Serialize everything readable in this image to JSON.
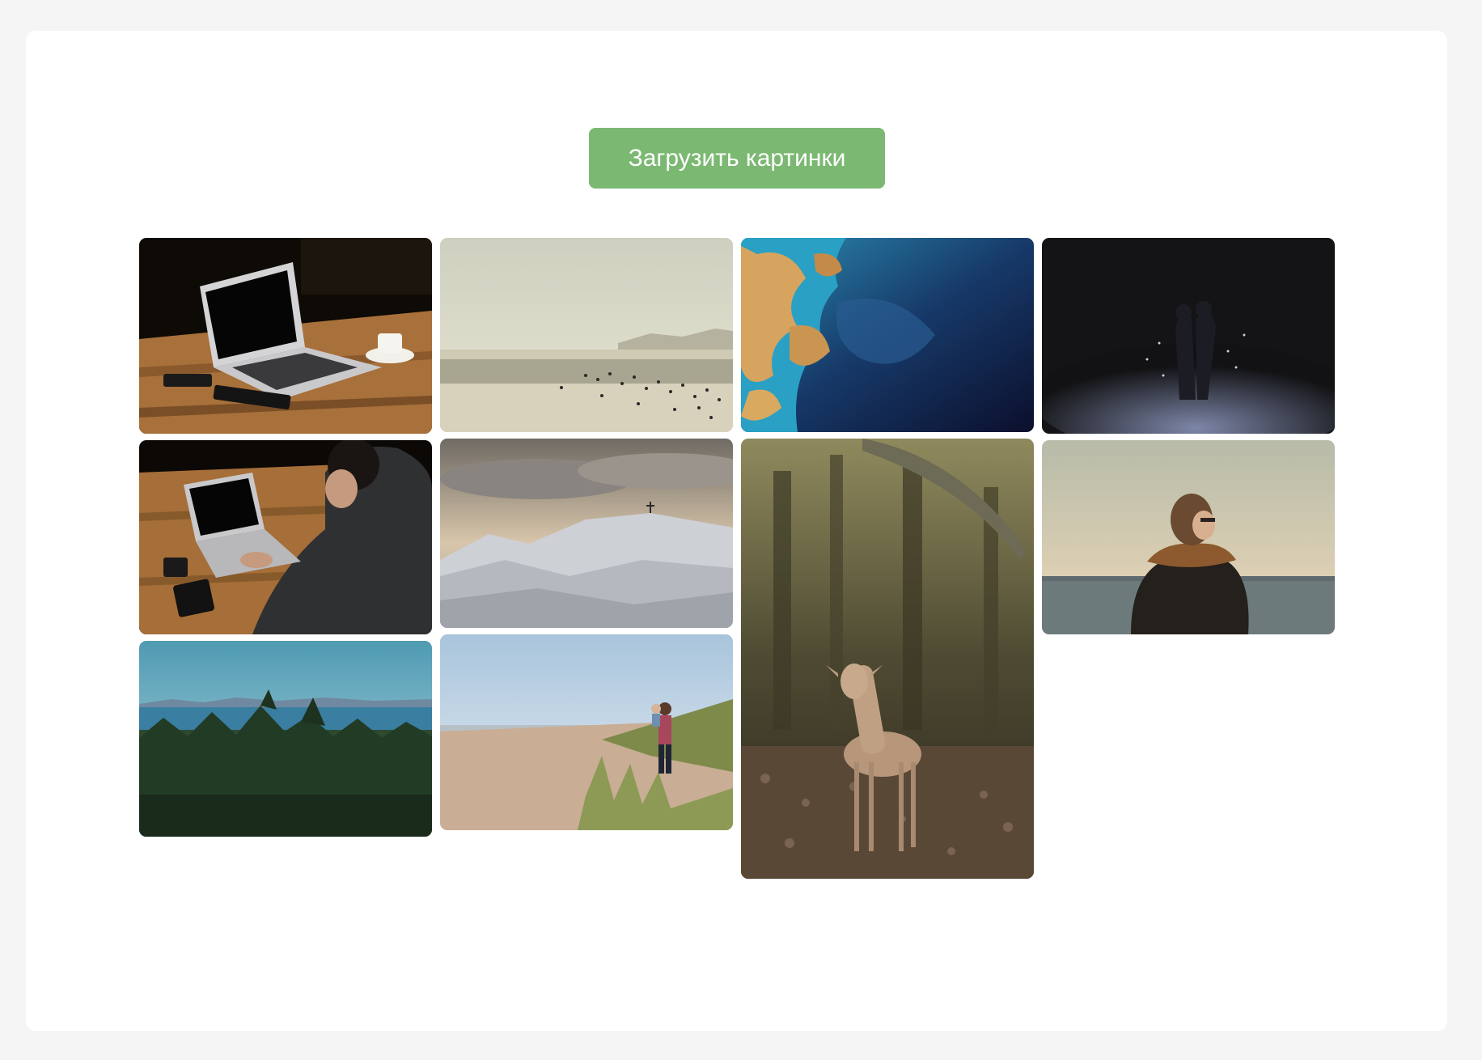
{
  "upload": {
    "label": "Загрузить картинки"
  },
  "colors": {
    "accent": "#7bb872",
    "background": "#f5f5f5",
    "card": "#ffffff"
  },
  "gallery": {
    "images": [
      {
        "subject": "laptop on wooden table with coffee cup"
      },
      {
        "subject": "hazy beach with crowd of people"
      },
      {
        "subject": "aerial satellite view of ocean and coast"
      },
      {
        "subject": "couple kissing in dark snow"
      },
      {
        "subject": "man typing on laptop at wooden table"
      },
      {
        "subject": "snowy mountain with cross under cloudy sky"
      },
      {
        "subject": "deer fawn in autumn forest"
      },
      {
        "subject": "woman with scarf looking at sea"
      },
      {
        "subject": "forest and lake with mountains"
      },
      {
        "subject": "man carrying child on beach"
      }
    ]
  }
}
